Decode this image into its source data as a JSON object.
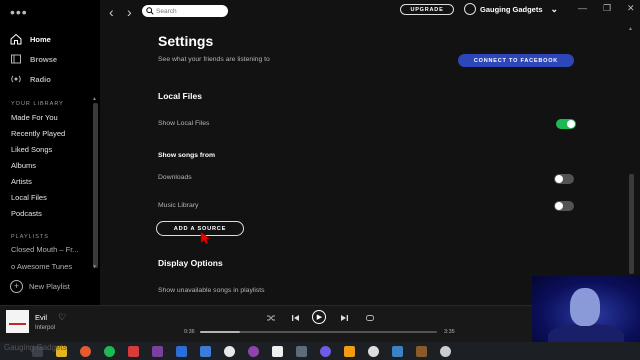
{
  "sidebar": {
    "nav": [
      {
        "label": "Home",
        "icon": "home-icon"
      },
      {
        "label": "Browse",
        "icon": "browse-icon"
      },
      {
        "label": "Radio",
        "icon": "radio-icon"
      }
    ],
    "library_label": "YOUR LIBRARY",
    "library_items": [
      "Made For You",
      "Recently Played",
      "Liked Songs",
      "Albums",
      "Artists",
      "Local Files",
      "Podcasts"
    ],
    "playlists_label": "PLAYLISTS",
    "playlists": [
      "Closed Mouth – Fr...",
      "Awesome Tunes"
    ],
    "new_playlist": "New Playlist"
  },
  "topbar": {
    "search_placeholder": "Search",
    "upgrade": "UPGRADE",
    "username": "Gauging Gadgets"
  },
  "settings": {
    "title": "Settings",
    "friends_text": "See what your friends are listening to",
    "connect_facebook": "CONNECT TO FACEBOOK",
    "local_files_heading": "Local Files",
    "show_local_files": "Show Local Files",
    "show_local_files_on": true,
    "show_songs_from": "Show songs from",
    "sources": [
      {
        "label": "Downloads",
        "on": false
      },
      {
        "label": "Music Library",
        "on": false
      }
    ],
    "add_source": "ADD A SOURCE",
    "display_heading": "Display Options",
    "unavailable_songs": "Show unavailable songs in playlists"
  },
  "player": {
    "track": "Evil",
    "artist": "Interpol",
    "elapsed": "0:36",
    "duration": "3:35",
    "progress": 0.17
  },
  "watermark": "Gauging Gadgets",
  "colors": {
    "accent": "#1db954",
    "facebook": "#2d46b9",
    "background": "#121212",
    "sidebar": "#000000"
  }
}
